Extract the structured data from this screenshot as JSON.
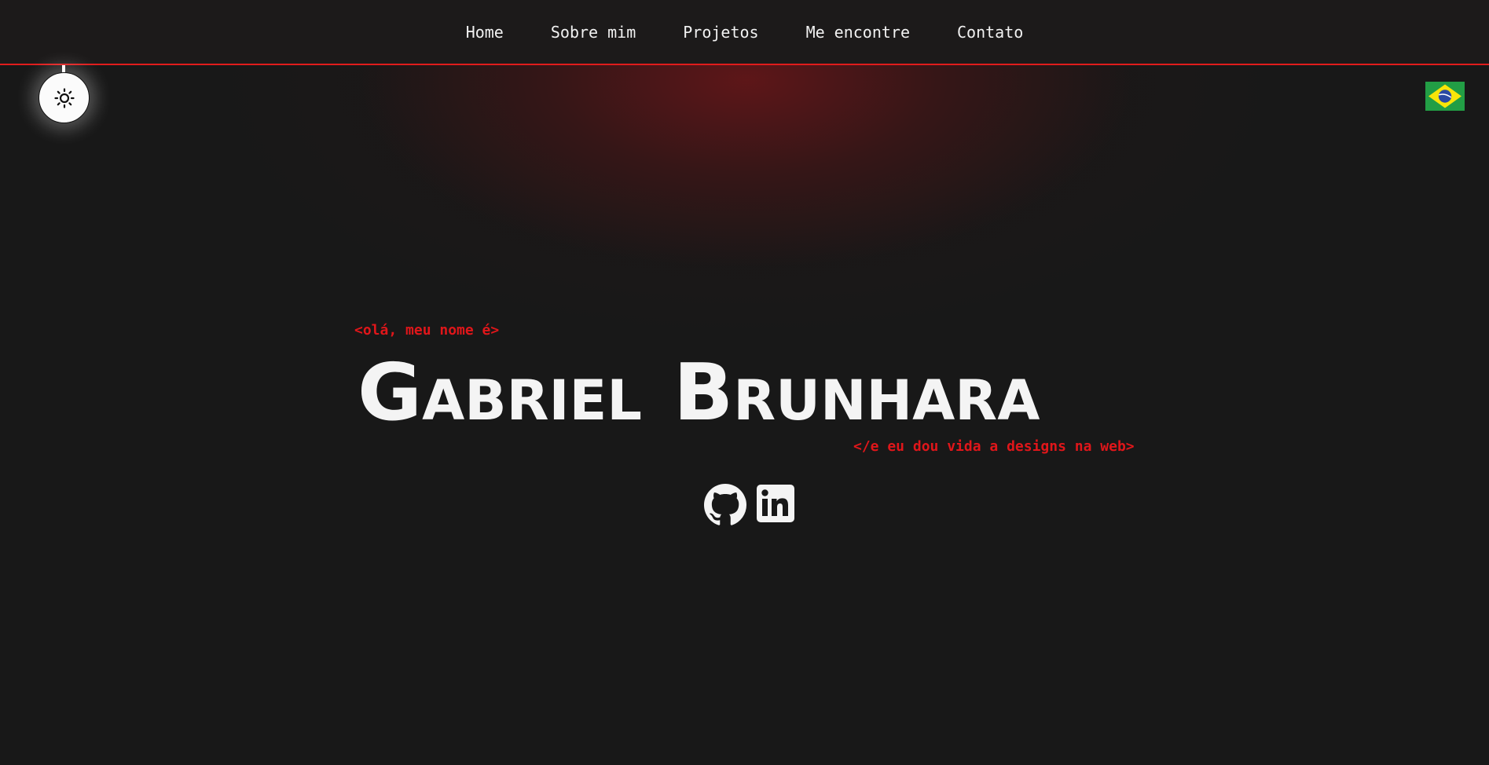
{
  "nav": {
    "items": [
      {
        "label": "Home"
      },
      {
        "label": "Sobre mim"
      },
      {
        "label": "Projetos"
      },
      {
        "label": "Me encontre"
      },
      {
        "label": "Contato"
      }
    ]
  },
  "theme_toggle": {
    "icon": "sun-icon"
  },
  "language": {
    "icon": "brazil-flag-icon"
  },
  "hero": {
    "greeting": "<olá, meu nome é>",
    "first_name": "Gabriel",
    "last_name": "Brunhara",
    "tagline": "</e eu dou vida a designs na web>"
  },
  "socials": [
    {
      "icon": "github-icon"
    },
    {
      "icon": "linkedin-icon"
    }
  ],
  "colors": {
    "accent": "#e0161a",
    "background": "#181818",
    "text": "#f4f4f4"
  }
}
